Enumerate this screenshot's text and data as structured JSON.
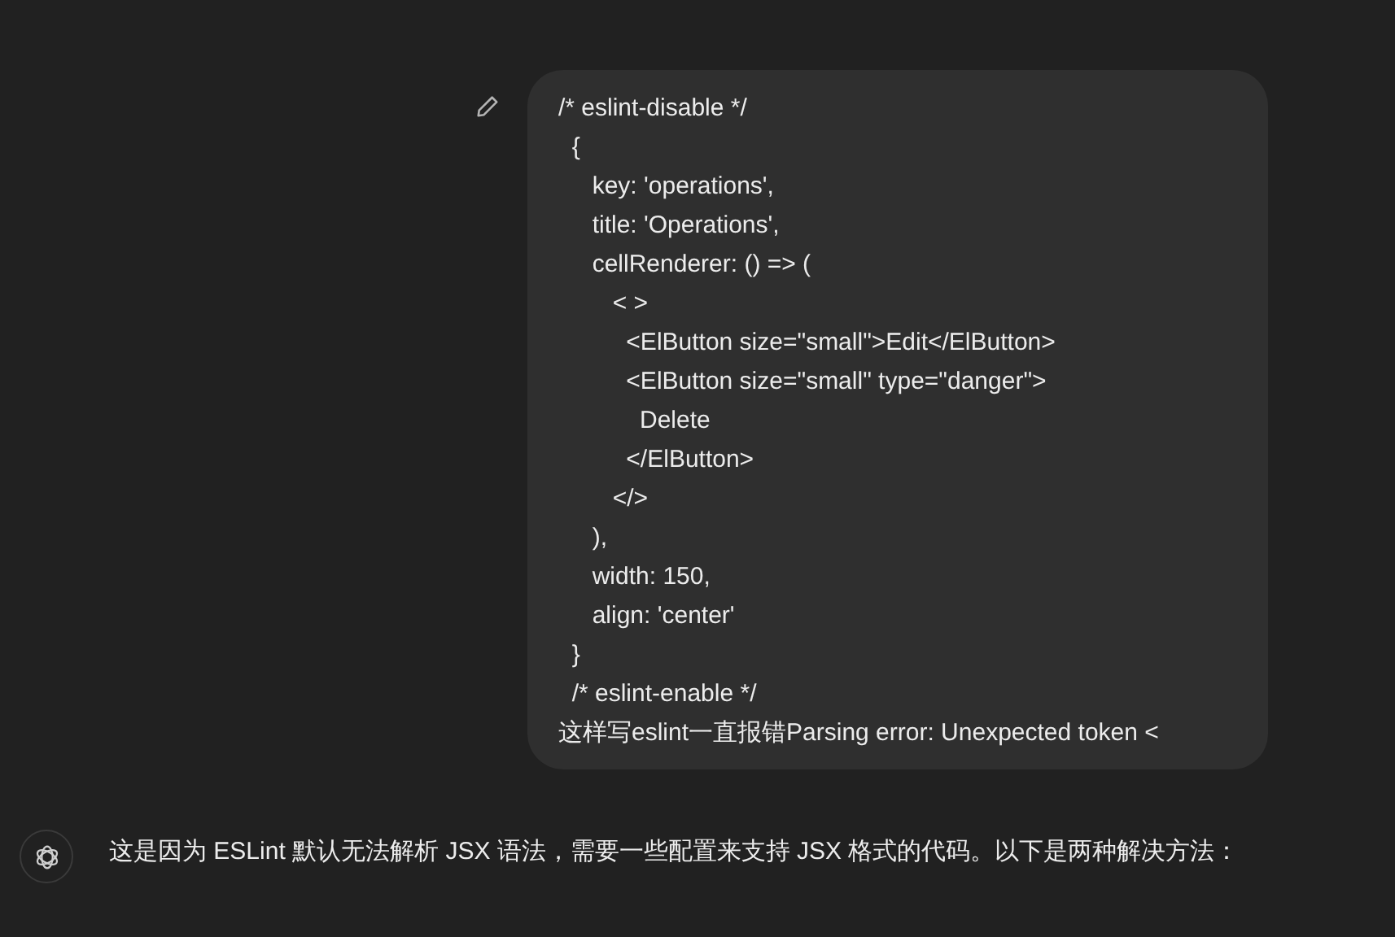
{
  "user_message": {
    "lines": [
      "/* eslint-disable */",
      "  {",
      "     key: 'operations',",
      "     title: 'Operations',",
      "     cellRenderer: () => (",
      "        < >",
      "          <ElButton size=\"small\">Edit</ElButton>",
      "          <ElButton size=\"small\" type=\"danger\">",
      "            Delete",
      "          </ElButton>",
      "        </>",
      "     ),",
      "     width: 150,",
      "     align: 'center'",
      "  }",
      "  /* eslint-enable */",
      "这样写eslint一直报错Parsing error: Unexpected token <"
    ]
  },
  "assistant_message": {
    "text": "这是因为 ESLint 默认无法解析 JSX 语法，需要一些配置来支持 JSX 格式的代码。以下是两种解决方法："
  }
}
